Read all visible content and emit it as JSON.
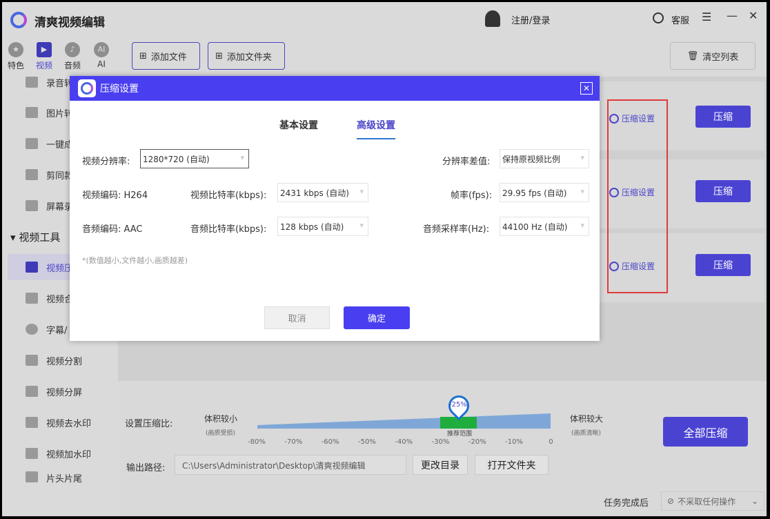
{
  "app": {
    "title": "清爽视频编辑",
    "login": "注册/登录",
    "service": "客服"
  },
  "categories": [
    {
      "label": "特色",
      "icon": "★"
    },
    {
      "label": "视频",
      "icon": "▶"
    },
    {
      "label": "音频",
      "icon": "♪"
    },
    {
      "label": "AI",
      "icon": "AI"
    }
  ],
  "toolbar": {
    "add_file": "添加文件",
    "add_folder": "添加文件夹",
    "clear_list": "清空列表"
  },
  "sidebar": {
    "items_top": [
      "录音转",
      "图片转",
      "一键成",
      "剪同款",
      "屏幕录"
    ],
    "section": "视频工具",
    "items": [
      "视频压",
      "视频合",
      "字幕/",
      "视频分割",
      "视频分屏",
      "视频去水印",
      "视频加水印",
      "片头片尾"
    ]
  },
  "rows": [
    {
      "settings": "压缩设置",
      "compress": "压缩"
    },
    {
      "settings": "压缩设置",
      "compress": "压缩"
    },
    {
      "settings": "压缩设置",
      "compress": "压缩"
    }
  ],
  "dialog": {
    "title": "压缩设置",
    "tabs": [
      "基本设置",
      "高级设置"
    ],
    "resolution_label": "视频分辨率:",
    "resolution": "1280*720 (自动)",
    "interp_label": "分辨率差值:",
    "interp": "保持原视频比例",
    "vcodec": "视频编码: H264",
    "vbitrate_label": "视频比特率(kbps):",
    "vbitrate": "2431 kbps (自动)",
    "fps_label": "帧率(fps):",
    "fps": "29.95 fps (自动)",
    "acodec": "音频编码: AAC",
    "abitrate_label": "音频比特率(kbps):",
    "abitrate": "128 kbps (自动)",
    "srate_label": "音频采样率(Hz):",
    "srate": "44100 Hz (自动)",
    "note": "*(数值越小,文件越小,画质越差)",
    "cancel": "取消",
    "ok": "确定"
  },
  "bottom": {
    "ratio_label": "设置压缩比:",
    "small": "体积较小",
    "small_sub": "(画质受损)",
    "large": "体积较大",
    "large_sub": "(画质清晰)",
    "ticks": [
      "-80%",
      "-70%",
      "-60%",
      "-50%",
      "-40%",
      "-30%",
      "-20%",
      "-10%",
      "0"
    ],
    "value": "-25%",
    "value_pct": -25,
    "recommend": "推荐范围",
    "path_label": "输出路径:",
    "path": "C:\\Users\\Administrator\\Desktop\\清爽视频编辑",
    "change_dir": "更改目录",
    "open_folder": "打开文件夹",
    "compress_all": "全部压缩",
    "after_label": "任务完成后",
    "after_value": "不采取任何操作"
  }
}
